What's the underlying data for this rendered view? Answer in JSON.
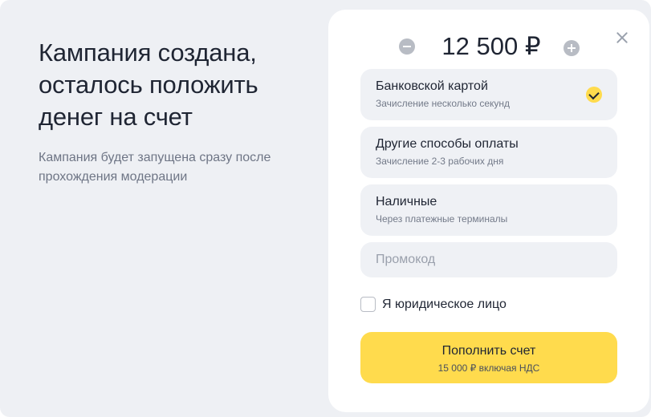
{
  "heading": {
    "title_line1": "Кампания создана,",
    "title_line2": "осталось положить",
    "title_line3": "денег на счет",
    "subtitle_line1": "Кампания будет запущена сразу после",
    "subtitle_line2": "прохождения модерации"
  },
  "amount": {
    "value": "12 500 ₽",
    "decrease_icon": "minus-circle-icon",
    "increase_icon": "plus-circle-icon"
  },
  "payment_methods": [
    {
      "title": "Банковской картой",
      "subtitle": "Зачисление несколько секунд",
      "selected": true
    },
    {
      "title": "Другие способы оплаты",
      "subtitle": "Зачисление 2-3 рабочих дня",
      "selected": false
    },
    {
      "title": "Наличные",
      "subtitle": "Через платежные терминалы",
      "selected": false
    }
  ],
  "promo": {
    "placeholder": "Промокод",
    "value": ""
  },
  "legal_entity": {
    "label": "Я юридическое лицо",
    "checked": false
  },
  "submit": {
    "label": "Пополнить счет",
    "sublabel": "15 000 ₽ включая НДС"
  },
  "colors": {
    "accent": "#ffdb4d",
    "background": "#eef0f4",
    "panel": "#ffffff",
    "option_bg": "#eff1f5",
    "text": "#1f2533"
  },
  "icons": {
    "close": "close-icon",
    "selected": "check-icon"
  }
}
